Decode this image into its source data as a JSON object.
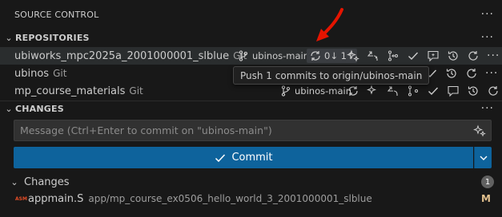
{
  "header": {
    "title": "SOURCE CONTROL"
  },
  "repositories": {
    "title": "REPOSITORIES",
    "items": [
      {
        "name": "ubiworks_mpc2025a_2001000001_slblue",
        "type": "Git",
        "branch": "ubinos-main*",
        "sync": "0↓ 1↑"
      },
      {
        "name": "ubinos",
        "type": "Git"
      },
      {
        "name": "mp_course_materials",
        "type": "Git",
        "branch": "ubinos-main"
      }
    ]
  },
  "tooltip": {
    "text": "Push 1 commits to origin/ubinos-main"
  },
  "changes_section": {
    "title": "CHANGES",
    "message_placeholder": "Message (Ctrl+Enter to commit on \"ubinos-main\")",
    "commit_label": "Commit",
    "group_label": "Changes",
    "count": "1",
    "files": [
      {
        "icon_text": "ASM",
        "name": "appmain.S",
        "path": "app/mp_course_ex0506_hello_world_3_2001000001_slblue",
        "status": "M"
      }
    ]
  },
  "colors": {
    "accent": "#0e639c",
    "annotation_arrow": "#e51400",
    "modified": "#e2c08d"
  }
}
